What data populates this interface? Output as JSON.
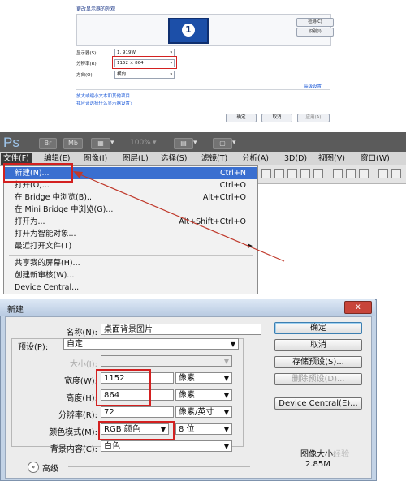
{
  "display_settings": {
    "title": "更改显示器的外观",
    "monitor_number": "1",
    "detect_button": "检测(C)",
    "identify_button": "识别(I)",
    "display_label": "显示器(S):",
    "display_value": "1. 919W",
    "resolution_label": "分辨率(R):",
    "resolution_value": "1152 × 864",
    "orientation_label": "方向(O):",
    "orientation_value": "横向",
    "advanced_link": "高级设置",
    "link_text_size": "放大或缩小文本和其他项目",
    "link_choose": "我应该选择什么显示器设置？",
    "ok_button": "确定",
    "cancel_button": "取消",
    "apply_button": "应用(A)"
  },
  "photoshop": {
    "logo": "Ps",
    "toolbar": [
      "Br",
      "Mb"
    ],
    "zoom": "100%",
    "menus": [
      "文件(F)",
      "编辑(E)",
      "图像(I)",
      "图层(L)",
      "选择(S)",
      "滤镜(T)",
      "分析(A)",
      "3D(D)",
      "视图(V)",
      "窗口(W)"
    ],
    "file_menu": [
      {
        "label": "新建(N)...",
        "shortcut": "Ctrl+N"
      },
      {
        "label": "打开(O)...",
        "shortcut": "Ctrl+O"
      },
      {
        "label": "在 Bridge 中浏览(B)...",
        "shortcut": "Alt+Ctrl+O"
      },
      {
        "label": "在 Mini Bridge 中浏览(G)...",
        "shortcut": ""
      },
      {
        "label": "打开为...",
        "shortcut": "Alt+Shift+Ctrl+O"
      },
      {
        "label": "打开为智能对象...",
        "shortcut": ""
      },
      {
        "label": "最近打开文件(T)",
        "shortcut": ""
      },
      {
        "label": "共享我的屏幕(H)...",
        "shortcut": ""
      },
      {
        "label": "创建新审核(W)...",
        "shortcut": ""
      },
      {
        "label": "Device Central...",
        "shortcut": ""
      }
    ]
  },
  "new_dialog": {
    "title": "新建",
    "close": "x",
    "name_label": "名称(N):",
    "name_value": "桌面背景图片",
    "preset_label": "预设(P):",
    "preset_value": "自定",
    "size_label": "大小(I):",
    "width_label": "宽度(W):",
    "width_value": "1152",
    "width_unit": "像素",
    "height_label": "高度(H):",
    "height_value": "864",
    "height_unit": "像素",
    "resolution_label": "分辨率(R):",
    "resolution_value": "72",
    "resolution_unit": "像素/英寸",
    "color_mode_label": "颜色模式(M):",
    "color_mode_value": "RGB 颜色",
    "bit_depth": "8 位",
    "background_label": "背景内容(C):",
    "background_value": "白色",
    "advanced_label": "高级",
    "ok_button": "确定",
    "cancel_button": "取消",
    "save_preset_button": "存储预设(S)...",
    "delete_preset_button": "删除预设(D)...",
    "device_central_button": "Device Central(E)...",
    "image_size_label": "图像大小:",
    "image_size_value": "2.85M",
    "watermark": "经验"
  }
}
